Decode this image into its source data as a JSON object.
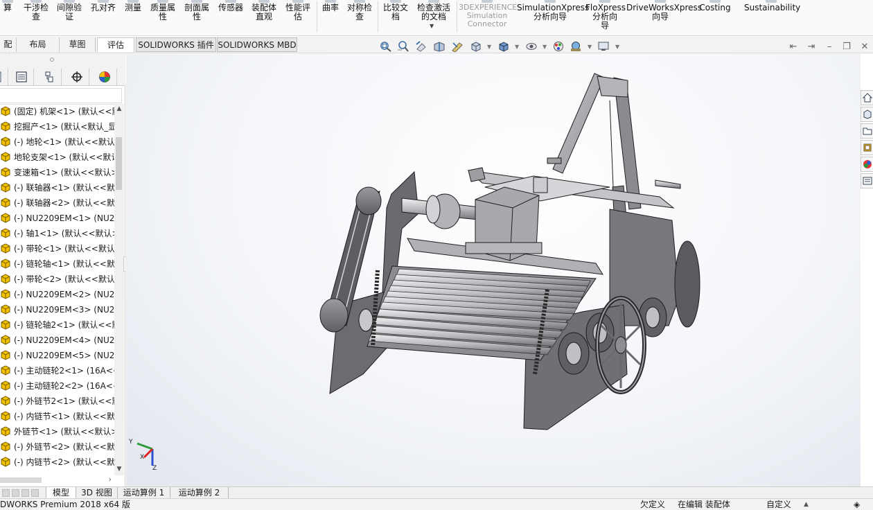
{
  "ribbon": {
    "items": [
      {
        "label": "算\n",
        "dim": false
      },
      {
        "label": "干涉检\n查",
        "dim": false
      },
      {
        "label": "间隙验\n证",
        "dim": false
      },
      {
        "label": "孔对齐",
        "dim": false
      },
      {
        "label": "测量",
        "dim": false
      },
      {
        "label": "质量属\n性",
        "dim": false
      },
      {
        "label": "剖面属\n性",
        "dim": false
      },
      {
        "label": "传感器",
        "dim": false
      },
      {
        "label": "装配体\n直观",
        "dim": false
      },
      {
        "label": "性能评\n估",
        "dim": false
      },
      {
        "label": "曲率",
        "dim": false
      },
      {
        "label": "对称检\n查",
        "dim": false
      },
      {
        "label": "比较文\n档",
        "dim": false
      },
      {
        "label": "检查激活\n的文档",
        "dim": false
      },
      {
        "label": "3DEXPERIENCE\nSimulation\nConnector",
        "dim": true
      },
      {
        "label": "SimulationXpress\n分析向导",
        "dim": false
      },
      {
        "label": "FloXpress\n分析向\n导",
        "dim": false
      },
      {
        "label": "DriveWorksXpress\n向导",
        "dim": false
      },
      {
        "label": "Costing",
        "dim": false
      },
      {
        "label": "Sustainability",
        "dim": false
      }
    ]
  },
  "command_tabs": [
    "配体",
    "布局",
    "草图",
    "评估",
    "SOLIDWORKS 插件",
    "SOLIDWORKS MBD"
  ],
  "active_command_tab": "评估",
  "view_toolbar_icons": [
    "zoom-to-fit-icon",
    "zoom-to-area-icon",
    "previous-view-icon",
    "section-view-icon",
    "dynamic-annotation-view-icon",
    "view-orientation-icon",
    "display-style-icon",
    "hide-show-items-icon",
    "edit-appearance-icon",
    "apply-scene-icon",
    "view-settings-icon"
  ],
  "feature_manager": {
    "tabs": [
      "featuremanager-tree-icon",
      "propertymanager-icon",
      "configurationmanager-icon",
      "dimxpertmanager-icon",
      "displaymanager-icon"
    ],
    "tree_items": [
      "(固定) 机架<1> (默认<<默",
      "挖掘产<1> (默认<默认_显",
      "(-) 地轮<1> (默认<<默认>",
      "地轮支架<1> (默认<<默认",
      "变速箱<1> (默认<<默认>",
      "(-) 联轴器<1> (默认<<默认",
      "(-) 联轴器<2> (默认<<默认",
      "(-) NU2209EM<1> (NU22",
      "(-) 轴1<1> (默认<<默认>",
      "(-) 带轮<1> (默认<<默认>",
      "(-) 链轮轴<1> (默认<<默认",
      "(-) 带轮<2> (默认<<默认>",
      "(-) NU2209EM<2> (NU22",
      "(-) NU2209EM<3> (NU22",
      "(-) 链轮轴2<1> (默认<<默",
      "(-) NU2209EM<4> (NU22",
      "(-) NU2209EM<5> (NU22",
      "(-) 主动链轮2<1> (16A<<",
      "(-) 主动链轮2<2> (16A<<",
      "(-) 外链节2<1> (默认<<默",
      "(-) 内链节<1> (默认<<默认",
      "外链节<1> (默认<<默认>",
      "(-) 外链节<2> (默认<<默认",
      "(-) 内链节<2> (默认<<默认"
    ]
  },
  "triad": {
    "y": "Y",
    "x": "X",
    "z": "Z"
  },
  "bottom_tabs": [
    "模型",
    "3D 视图",
    "运动算例 1",
    "运动算例 2"
  ],
  "active_bottom_tab": "模型",
  "status": {
    "app": "DWORKS Premium 2018 x64 版",
    "undefined": "欠定义",
    "editing": "在编辑 装配体",
    "custom": "自定义"
  },
  "colors": {
    "accent": "#1f6fb2",
    "part_icon": "#f2c200",
    "model_gray": "#7b7b80"
  }
}
